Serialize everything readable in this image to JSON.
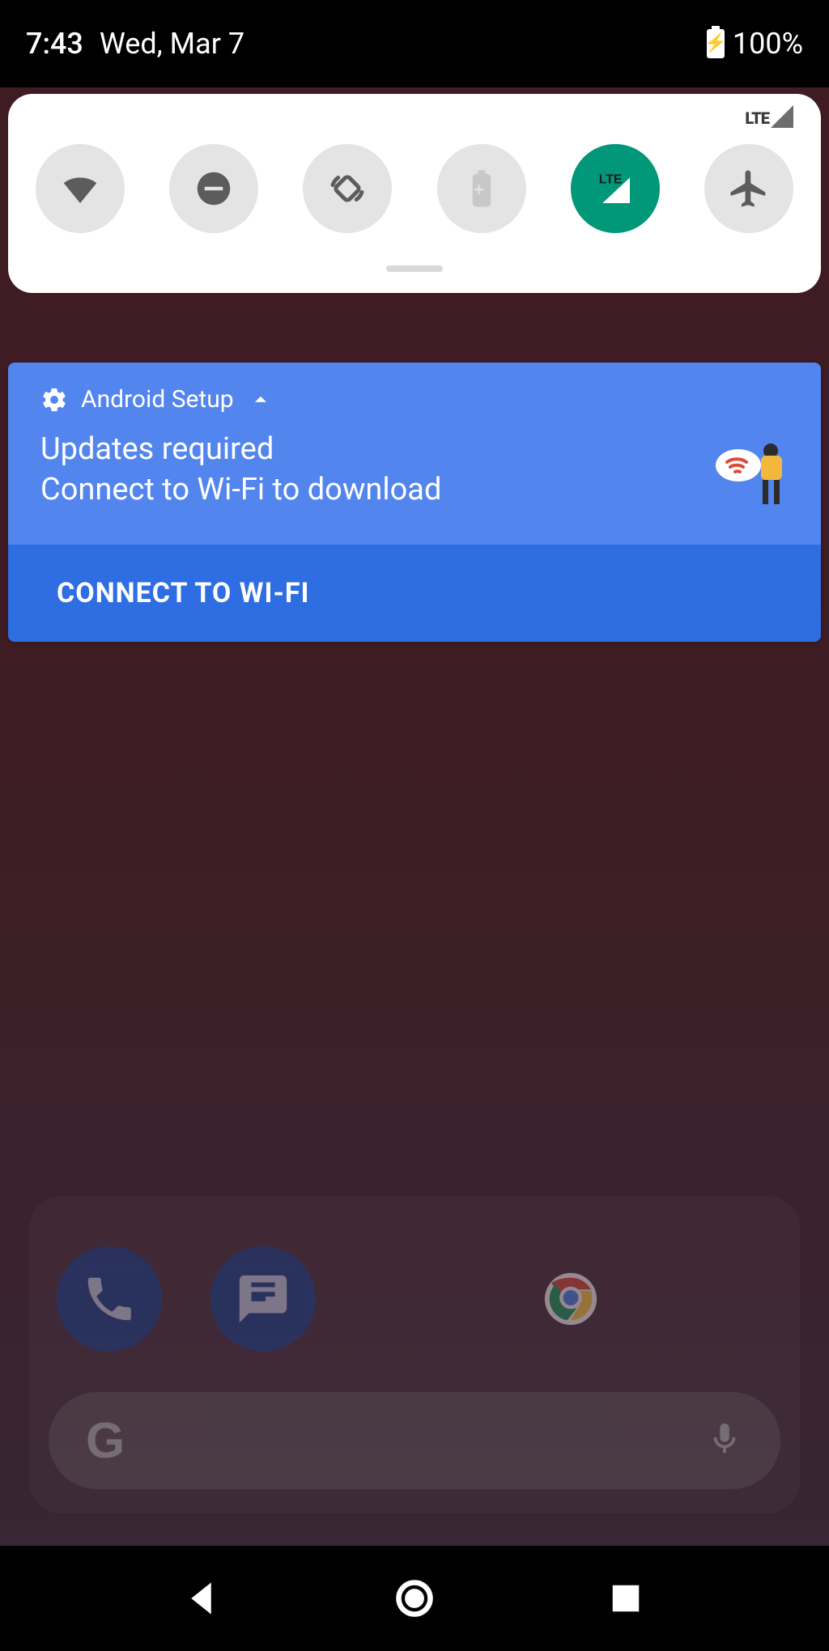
{
  "status": {
    "time": "7:43",
    "date": "Wed, Mar 7",
    "battery_pct": "100%",
    "signal_label": "LTE"
  },
  "quick_settings": {
    "signal_label": "LTE",
    "tiles": [
      {
        "name": "wifi",
        "active": false
      },
      {
        "name": "do-not-disturb",
        "active": false
      },
      {
        "name": "auto-rotate",
        "active": false
      },
      {
        "name": "battery-saver",
        "active": false
      },
      {
        "name": "mobile-data",
        "active": true,
        "label": "LTE"
      },
      {
        "name": "airplane-mode",
        "active": false
      }
    ]
  },
  "notification": {
    "app_name": "Android Setup",
    "title": "Updates required",
    "subtitle": "Connect to Wi-Fi to download",
    "action_label": "CONNECT TO WI-FI"
  },
  "dock": {
    "apps": [
      "phone",
      "messages",
      "chrome"
    ]
  },
  "search": {
    "placeholder": ""
  },
  "nav": {
    "back": "back",
    "home": "home",
    "recent": "recent"
  }
}
